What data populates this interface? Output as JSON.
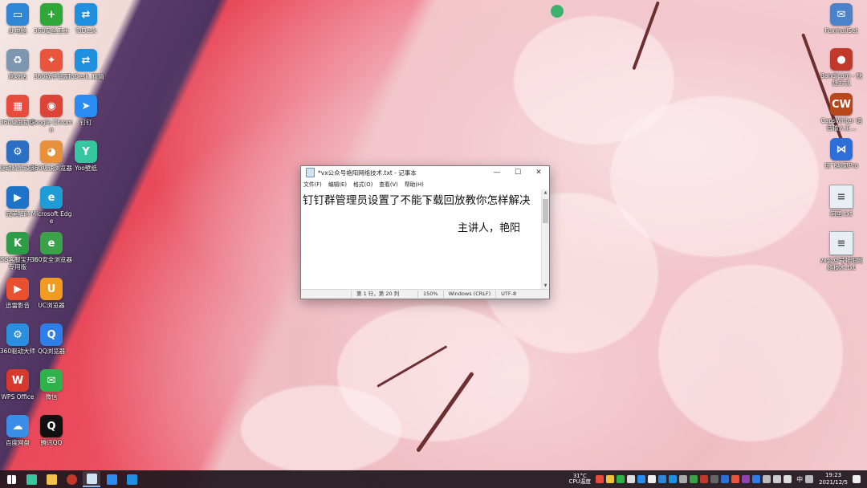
{
  "desktop": {
    "left_icons": [
      {
        "label": "此电脑",
        "icon": "computer-icon",
        "color": "#2f86d6",
        "glyph": "▭"
      },
      {
        "label": "360安全卫士",
        "icon": "360-safe-icon",
        "color": "#2fa83a",
        "glyph": "+"
      },
      {
        "label": "ToDesk",
        "icon": "todesk-icon",
        "color": "#1f8fe0",
        "glyph": "⇄"
      },
      {
        "label": "回收站",
        "icon": "recycle-bin-icon",
        "color": "#7e97b0",
        "glyph": "♻"
      },
      {
        "label": "360软件管家",
        "icon": "360-software-manager-icon",
        "color": "#e8543c",
        "glyph": "✦"
      },
      {
        "label": "ToDesk_精简",
        "icon": "todesk-lite-icon",
        "color": "#1f8fe0",
        "glyph": "⇄"
      },
      {
        "label": "360桌面助手",
        "icon": "360-desktop-icon",
        "color": "#e84c3d",
        "glyph": "▦"
      },
      {
        "label": "Google Chrome",
        "icon": "chrome-icon",
        "color": "#db4437",
        "glyph": "◉"
      },
      {
        "label": "钉钉",
        "icon": "dingtalk-icon",
        "color": "#2a8cf0",
        "glyph": "➤"
      },
      {
        "label": "驱动精灵设置",
        "icon": "driver-genius-icon",
        "color": "#2b6fc4",
        "glyph": "⚙"
      },
      {
        "label": "360极速浏览器",
        "icon": "360-browser-icon",
        "color": "#e8913c",
        "glyph": "◕"
      },
      {
        "label": "Yoo壁纸",
        "icon": "yoo-wallpaper-icon",
        "color": "#36c6a0",
        "glyph": "Y"
      },
      {
        "label": "完美解码",
        "icon": "perfect-decoder-icon",
        "color": "#1e73c8",
        "glyph": "▶"
      },
      {
        "label": "Microsoft Edge",
        "icon": "edge-icon",
        "color": "#1f9bd6",
        "glyph": "e"
      },
      {
        "label": "",
        "icon": "",
        "color": "",
        "glyph": ""
      },
      {
        "label": "KSS客服宝开发专用版",
        "icon": "kss-icon",
        "color": "#2f9d48",
        "glyph": "K"
      },
      {
        "label": "360安全浏览器",
        "icon": "360-secure-browser-icon",
        "color": "#3aa34a",
        "glyph": "e"
      },
      {
        "label": "",
        "icon": "",
        "color": "",
        "glyph": ""
      },
      {
        "label": "迅雷影音",
        "icon": "thunder-player-icon",
        "color": "#e85030",
        "glyph": "▶"
      },
      {
        "label": "UC浏览器",
        "icon": "uc-browser-icon",
        "color": "#f29b22",
        "glyph": "U"
      },
      {
        "label": "",
        "icon": "",
        "color": "",
        "glyph": ""
      },
      {
        "label": "360驱动大师",
        "icon": "360-driver-icon",
        "color": "#2b8fe0",
        "glyph": "⚙"
      },
      {
        "label": "QQ浏览器",
        "icon": "qq-browser-icon",
        "color": "#2f7ee8",
        "glyph": "Q"
      },
      {
        "label": "",
        "icon": "",
        "color": "",
        "glyph": ""
      },
      {
        "label": "WPS Office",
        "icon": "wps-icon",
        "color": "#d8382e",
        "glyph": "W"
      },
      {
        "label": "微信",
        "icon": "wechat-icon",
        "color": "#2fb24a",
        "glyph": "✉"
      },
      {
        "label": "",
        "icon": "",
        "color": "",
        "glyph": ""
      },
      {
        "label": "百度网盘",
        "icon": "baidu-netdisk-icon",
        "color": "#3c8de8",
        "glyph": "☁"
      },
      {
        "label": "腾讯QQ",
        "icon": "qq-icon",
        "color": "#111111",
        "glyph": "Q"
      }
    ],
    "right_icons": [
      {
        "label": "FoxmailSet",
        "icon": "foxmail-icon",
        "color": "#4b82c9",
        "glyph": "✉"
      },
      {
        "label": "Bandicam - 快捷方式",
        "icon": "bandicam-icon",
        "color": "#c0392b",
        "glyph": "●"
      },
      {
        "label": "CapsWriter 语音输入工...",
        "icon": "capswriter-icon",
        "color": "#b8471c",
        "glyph": "CW"
      },
      {
        "label": "讯飞听见Pro",
        "icon": "iflytek-icon",
        "color": "#2d6fd8",
        "glyph": "⋈"
      },
      {
        "label": "阿里.txt",
        "icon": "text-file-icon",
        "color": "#e9eef4",
        "glyph": "≡"
      },
      {
        "label": "vx公众号艳阳网络技术.txt",
        "icon": "text-file-icon",
        "color": "#e9eef4",
        "glyph": "≡"
      }
    ],
    "top_icon": {
      "label": "",
      "icon": "frog-icon"
    }
  },
  "notepad": {
    "title": "*vx公众号艳阳网络技术.txt - 记事本",
    "menu": [
      "文件(F)",
      "编辑(E)",
      "格式(O)",
      "查看(V)",
      "帮助(H)"
    ],
    "line1": "钉钉群管理员设置了不能下载回放教你怎样解决",
    "line2": "主讲人，艳阳",
    "status": {
      "position": "第 1 行，第 20 列",
      "zoom": "150%",
      "eol": "Windows (CRLF)",
      "encoding": "UTF-8"
    }
  },
  "taskbar": {
    "apps": [
      {
        "icon": "start-icon",
        "color": "#ffffff"
      },
      {
        "icon": "yoo-wallpaper-icon",
        "color": "#36c6a0"
      },
      {
        "icon": "file-explorer-icon",
        "color": "#f2c14e"
      },
      {
        "icon": "bandicam-icon",
        "color": "#c0392b"
      },
      {
        "icon": "notepad-icon",
        "color": "#cfe3f5"
      },
      {
        "icon": "dingtalk-icon",
        "color": "#2a8cf0"
      },
      {
        "icon": "todesk-icon",
        "color": "#1f8fe0"
      }
    ],
    "weather_temp": "31°C",
    "weather_label": "CPU温度",
    "ime": "中",
    "time": "19:23",
    "date": "2021/12/5"
  }
}
